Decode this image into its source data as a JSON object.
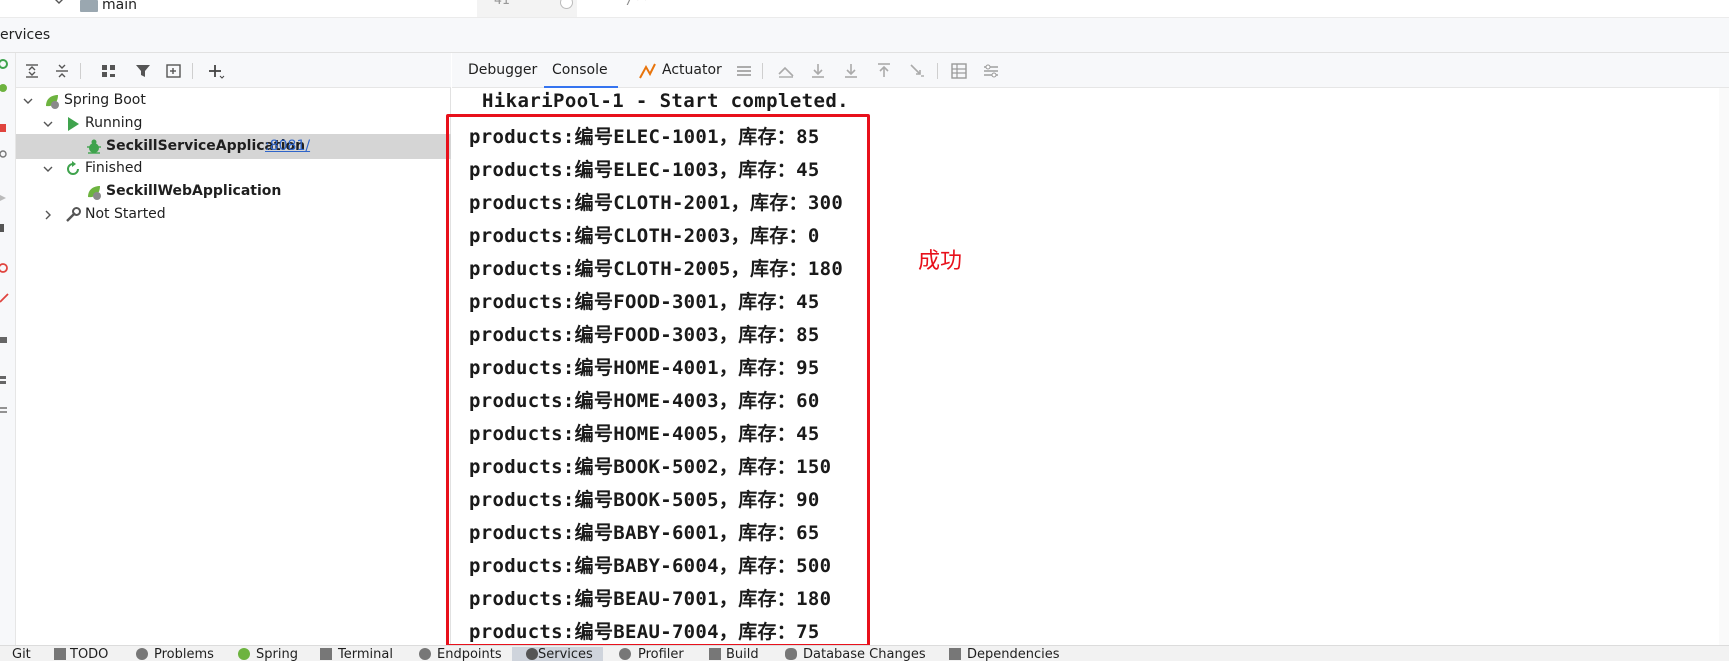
{
  "top": {
    "folder_label": "main",
    "gutter_line_number": "41",
    "gutter_code": "/**"
  },
  "services": {
    "title": "ervices"
  },
  "tree": {
    "root": {
      "label": "Spring Boot"
    },
    "groups": [
      {
        "label": "Running",
        "items": [
          {
            "label": "SeckillServiceApplication",
            "port": ":8081/"
          }
        ]
      },
      {
        "label": "Finished",
        "items": [
          {
            "label": "SeckillWebApplication"
          }
        ]
      },
      {
        "label": "Not Started",
        "items": []
      }
    ]
  },
  "tabs": [
    {
      "label": "Debugger"
    },
    {
      "label": "Console"
    },
    {
      "label": "Actuator"
    }
  ],
  "console": {
    "first_line": "HikariPool-1 - Start completed.",
    "lines": [
      "products:编号ELEC-1001，库存：85",
      "products:编号ELEC-1003，库存：45",
      "products:编号CLOTH-2001，库存：300",
      "products:编号CLOTH-2003，库存：0",
      "products:编号CLOTH-2005，库存：180",
      "products:编号FOOD-3001，库存：45",
      "products:编号FOOD-3003，库存：85",
      "products:编号HOME-4001，库存：95",
      "products:编号HOME-4003，库存：60",
      "products:编号HOME-4005，库存：45",
      "products:编号BOOK-5002，库存：150",
      "products:编号BOOK-5005，库存：90",
      "products:编号BABY-6001，库存：65",
      "products:编号BABY-6004，库存：500",
      "products:编号BEAU-7001，库存：180",
      "products:编号BEAU-7004，库存：75"
    ]
  },
  "annotation": {
    "label": "成功",
    "color": "#e8101b"
  },
  "bottom_bar": {
    "items": [
      "Git",
      "TODO",
      "Problems",
      "Spring",
      "Terminal",
      "Endpoints",
      "Services",
      "Profiler",
      "Build",
      "Database Changes",
      "Dependencies"
    ],
    "active": "Services"
  },
  "colors": {
    "accent": "#3574f0",
    "spring_green": "#6db33f",
    "run_green": "#3fa34d",
    "link": "#2f65ca"
  }
}
